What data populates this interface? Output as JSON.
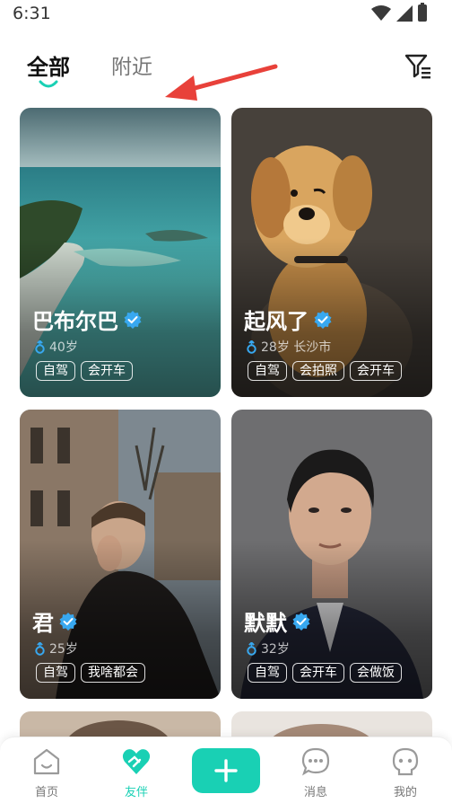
{
  "status": {
    "time": "6:31"
  },
  "tabs": {
    "all": "全部",
    "nearby": "附近"
  },
  "icons": {
    "filter": "filter-icon",
    "verified": "verified-badge-icon",
    "gender": "male-icon"
  },
  "colors": {
    "accent": "#19d0b4",
    "verify": "#38a8f0",
    "arrow": "#e8413a"
  },
  "cards": [
    {
      "name": "巴布尔巴",
      "meta": "40岁",
      "tags": [
        "自驾",
        "会开车"
      ]
    },
    {
      "name": "起风了",
      "meta": "28岁 长沙市",
      "tags": [
        "自驾",
        "会拍照",
        "会开车"
      ]
    },
    {
      "name": "君",
      "meta": "25岁",
      "tags": [
        "自驾",
        "我啥都会"
      ]
    },
    {
      "name": "默默",
      "meta": "32岁",
      "tags": [
        "自驾",
        "会开车",
        "会做饭"
      ]
    }
  ],
  "nav": {
    "home": "首页",
    "friends": "友伴",
    "messages": "消息",
    "mine": "我的"
  }
}
